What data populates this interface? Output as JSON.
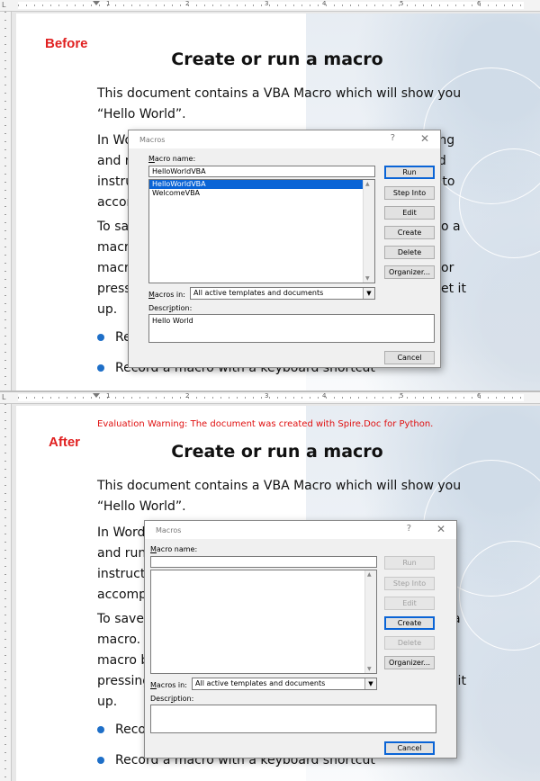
{
  "ruler": {
    "corner": "L",
    "numbers": [
      "1",
      "2",
      "3",
      "4",
      "5",
      "6"
    ]
  },
  "labels": {
    "before": "Before",
    "after": "After"
  },
  "warning": "Evaluation Warning: The document was created with Spire.Doc for Python.",
  "document": {
    "title": "Create or run a macro",
    "p1_l1": "This document contains a VBA Macro which will show you",
    "p1_l2": "“Hello World”.",
    "p2": [
      "In Word,",
      "and run",
      "instructi",
      "accompl"
    ],
    "p2_right": [
      "ting",
      "nd",
      "d to",
      ""
    ],
    "p3": [
      "To save",
      "macro. I",
      "macro b",
      "pressing",
      "up."
    ],
    "p3_right": [
      "o a",
      "",
      "or",
      "et it",
      ""
    ],
    "bullet1": "Reco",
    "bullet2": "Record a macro with a keyboard shortcut"
  },
  "dialog_before": {
    "title": "Macros",
    "help": "?",
    "close": "✕",
    "macro_name_label_u": "M",
    "macro_name_label": "acro name:",
    "macro_name_value": "HelloWorldVBA",
    "macros": [
      "HelloWorldVBA",
      "WelcomeVBA"
    ],
    "macros_in_label_u": "M",
    "macros_in_label": "acros in:",
    "macros_in_value": "All active templates and documents",
    "description_label": "Descr",
    "description_label_u": "i",
    "description_label_end": "ption:",
    "description_value": "Hello World",
    "buttons": {
      "run": "Run",
      "step_into": "Step Into",
      "edit": "Edit",
      "create": "Create",
      "delete": "Delete",
      "organizer": "Organizer...",
      "cancel": "Cancel"
    }
  },
  "dialog_after": {
    "title": "Macros",
    "help": "?",
    "close": "✕",
    "macro_name_label_u": "M",
    "macro_name_label": "acro name:",
    "macro_name_value": "",
    "macros": [],
    "macros_in_label_u": "M",
    "macros_in_label": "acros in:",
    "macros_in_value": "All active templates and documents",
    "description_label": "Descr",
    "description_label_u": "i",
    "description_label_end": "ption:",
    "description_value": "",
    "buttons": {
      "run": "Run",
      "step_into": "Step Into",
      "edit": "Edit",
      "create": "Create",
      "delete": "Delete",
      "organizer": "Organizer...",
      "cancel": "Cancel"
    }
  },
  "colors": {
    "accent_red": "#e02020",
    "selection_blue": "#0a64d6",
    "bullet_blue": "#1e6fc8"
  }
}
